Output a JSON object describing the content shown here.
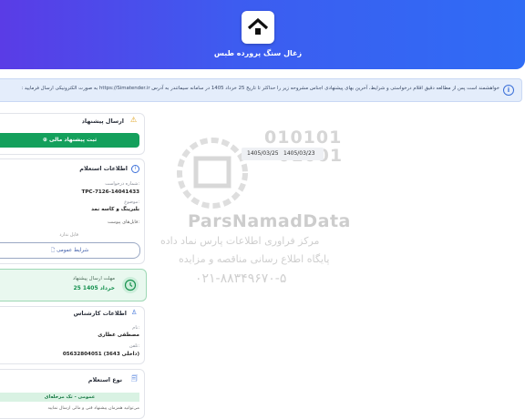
{
  "header": {
    "title": "زغال سنگ پرورده طبس"
  },
  "notice": {
    "text": "خواهشمند است پس از مطالعه دقیق اقلام درخواستی و شرایط، آخرین بهای پیشنهادی اجناس مشروحه زیر را حداکثر تا تاریخ 25 خرداد 1405 در سامانه سیماتندر به آدرس https://Simatender.ir به صورت الکترونیکی ارسال فرمایید :"
  },
  "submit_card": {
    "title": "ارسال پیشنهاد",
    "button_label": "ثبت پیشنهاد مالی"
  },
  "inquiry_card": {
    "title": "اطلاعات استعلام",
    "number_label": "شماره درخواست:",
    "number_value": "TPC-7126-14041433",
    "subject_label": "موضوع:",
    "subject_value": "بلبرینگ و کاسه نمد",
    "attachments_label": "فایل‌های پیوست:",
    "no_file_text": "فایل ندارد",
    "terms_button": "شرایط عمومی"
  },
  "deadline_card": {
    "label": "مهلت ارسال پیشنهاد",
    "value": "25 خرداد 1405"
  },
  "expert_card": {
    "title": "اطلاعات کارشناس",
    "name_label": "نام:",
    "name_value": "مصطفی عطاری",
    "phone_label": "تلفن:",
    "phone_value": "05632804051 (داخلی 3643)"
  },
  "type_card": {
    "title": "نوع استعلام",
    "tag": "عمومی - تک مرحله‌ای",
    "description": "می‌توانید همزمان پیشنهاد فنی و مالی ارسال نمایید"
  },
  "dates": {
    "start": "1405/03/23",
    "end": "1405/03/25"
  },
  "watermark": {
    "digits_1": "010101",
    "digits_2": "01001",
    "brand": "ParsNamadData",
    "line1": "مرکز فراوری اطلاعات پارس نماد داده",
    "line2": "پایگاه اطلاع رسانی مناقصه و مزایده",
    "phone": "۰۲۱-۸۸۳۴۹۶۷۰-۵"
  },
  "colors": {
    "header_start": "#5a3ce6",
    "header_end": "#2f6cf5",
    "primary_green": "#14a05c",
    "info_blue": "#3a6fd8"
  }
}
